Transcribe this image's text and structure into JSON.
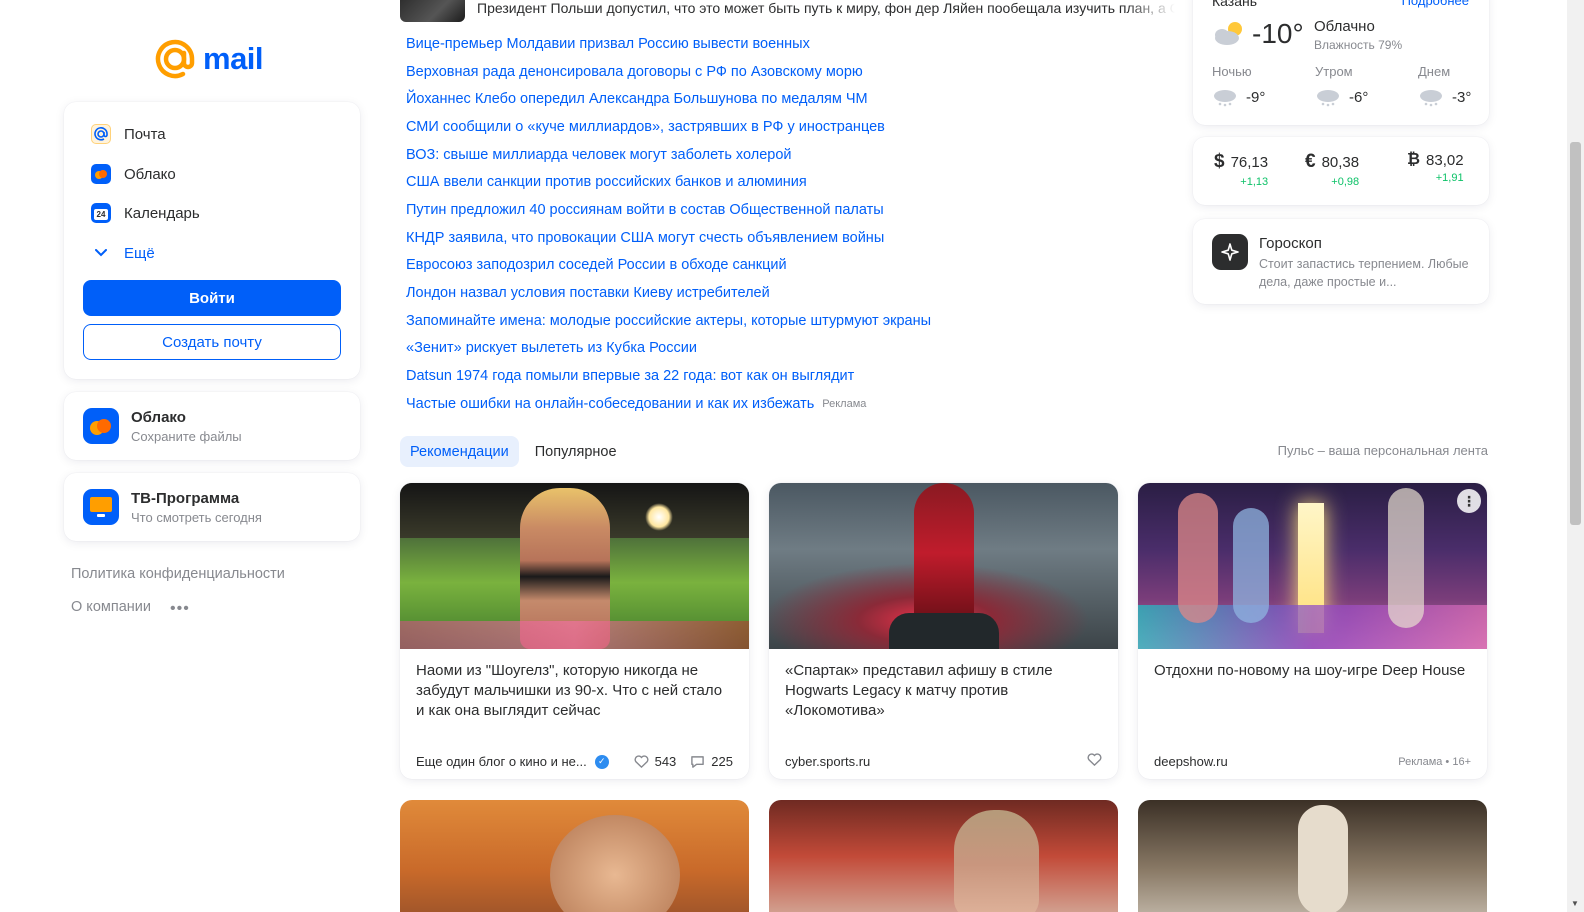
{
  "logo": {
    "text": "mail"
  },
  "services": {
    "items": [
      {
        "label": "Почта",
        "icon": "mail-at-icon"
      },
      {
        "label": "Облако",
        "icon": "cloud-icon"
      },
      {
        "label": "Календарь",
        "icon": "calendar-icon",
        "icon_text": "24"
      }
    ],
    "more_label": "Ещё",
    "login_label": "Войти",
    "create_label": "Создать почту"
  },
  "promos": [
    {
      "title": "Облако",
      "subtitle": "Сохраните файлы",
      "icon": "cloud-app-icon"
    },
    {
      "title": "ТВ-Программа",
      "subtitle": "Что смотреть сегодня",
      "icon": "tv-icon"
    }
  ],
  "footer": {
    "privacy": "Политика конфиденциальности",
    "about": "О компании",
    "more": "•••"
  },
  "top_news": {
    "text": "Президент Польши допустил, что это может быть путь к миру, фон дер Ляйен пообещала изучить план, а С"
  },
  "news": [
    "Вице-премьер Молдавии призвал Россию вывести военных",
    "Верховная рада денонсировала договоры с РФ по Азовскому морю",
    "Йоханнес Клебо опередил Александра Большунова по медалям ЧМ",
    "СМИ сообщили о «куче миллиардов», застрявших в РФ у иностранцев",
    "ВОЗ: свыше миллиарда человек могут заболеть холерой",
    "США ввели санкции против российских банков и алюминия",
    "Путин предложил 40 россиянам войти в состав Общественной палаты",
    "КНДР заявила, что провокации США могут счесть объявлением войны",
    "Евросоюз заподозрил соседей России в обходе санкций",
    "Лондон назвал условия поставки Киеву истребителей",
    "Запоминайте имена: молодые российские актеры, которые штурмуют экраны",
    "«Зенит» рискует вылететь из Кубка России",
    "Datsun 1974 года помыли впервые за 22 года: вот как он выглядит",
    "Частые ошибки на онлайн-собеседовании и как их избежать"
  ],
  "news_ad_label": "Реклама",
  "tabs": [
    "Рекомендации",
    "Популярное"
  ],
  "pulse_caption": "Пульс – ваша персональная лента",
  "feed": [
    {
      "title": "Наоми из \"Шоугелз\", которую никогда не забудут мальчишки из 90-х. Что с ней стало и как она выглядит сейчас",
      "source": "Еще один блог о кино и не...",
      "likes": "543",
      "comments": "225"
    },
    {
      "title": "«Спартак» представил афишу в стиле Hogwarts Legacy к матчу против «Локомотива»",
      "source": "cyber.sports.ru"
    },
    {
      "title": "Отдохни по-новому на шоу-игре Deep House",
      "source": "deepshow.ru",
      "ad": "Реклама • 16+"
    }
  ],
  "weather": {
    "city": "Казань",
    "more": "Подробнее",
    "temp": "-10°",
    "condition": "Облачно",
    "humidity": "Влажность 79%",
    "parts": [
      {
        "label": "Ночью",
        "temp": "-9°"
      },
      {
        "label": "Утром",
        "temp": "-6°"
      },
      {
        "label": "Днем",
        "temp": "-3°"
      }
    ]
  },
  "rates": [
    {
      "symbol": "$",
      "value": "76,13",
      "change": "+1,13"
    },
    {
      "symbol": "€",
      "value": "80,38",
      "change": "+0,98"
    },
    {
      "symbol": "₿",
      "value": "83,02",
      "change": "+1,91"
    }
  ],
  "horoscope": {
    "title": "Гороскоп",
    "text": "Стоит запастись терпением. Любые дела, даже простые и..."
  },
  "colors": {
    "accent": "#005ff9",
    "logo_orange": "#ff9e00",
    "positive": "#0dc268",
    "muted": "#87898f"
  }
}
